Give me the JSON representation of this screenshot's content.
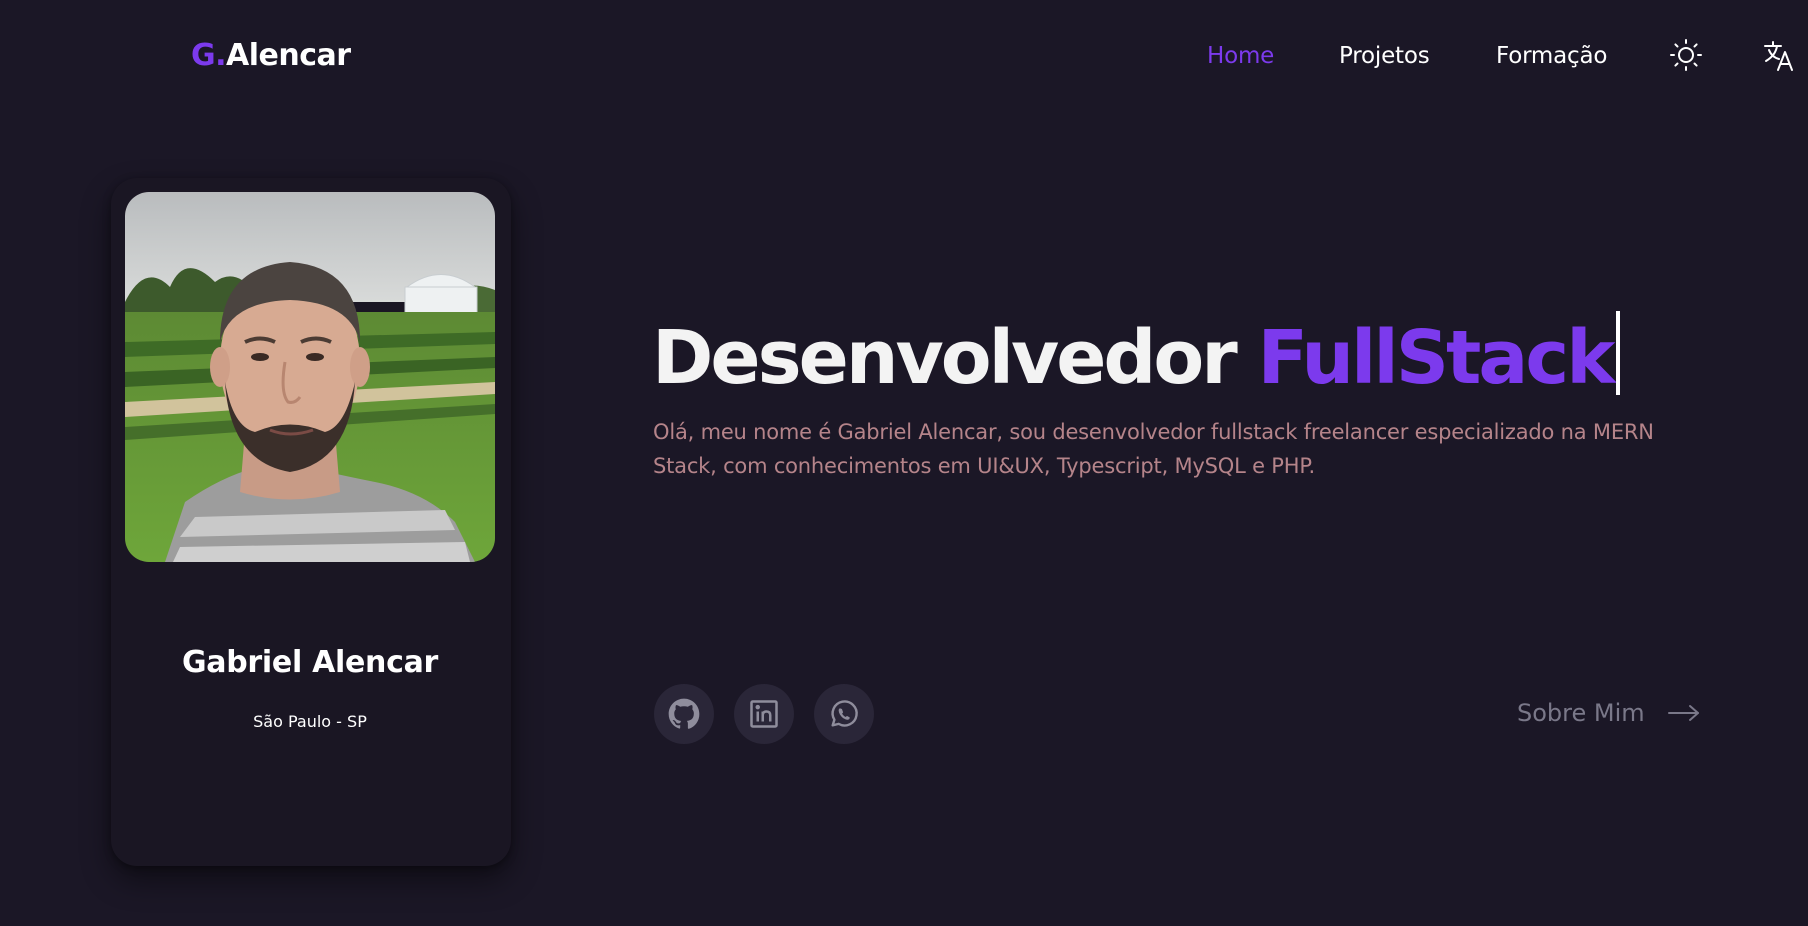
{
  "brand": {
    "accent": "G.",
    "rest": "Alencar"
  },
  "nav": {
    "home": "Home",
    "projetos": "Projetos",
    "formacao": "Formação",
    "theme_icon": "sun-icon",
    "lang_icon": "translate-icon"
  },
  "profile": {
    "name": "Gabriel Alencar",
    "location": "São Paulo - SP"
  },
  "hero": {
    "title_plain": "Desenvolvedor",
    "title_highlight": "FullStack",
    "description": "Olá, meu nome é Gabriel Alencar, sou desenvolvedor fullstack freelancer especializado na MERN Stack, com conhecimentos em UI&UX, Typescript, MySQL e PHP."
  },
  "social": {
    "icons": [
      "github-icon",
      "linkedin-icon",
      "whatsapp-icon"
    ]
  },
  "about": {
    "label": "Sobre Mim",
    "icon": "arrow-right-icon"
  },
  "colors": {
    "background": "#1b1726",
    "accent": "#7c3aed",
    "description_text": "#b5848a",
    "social_bg": "#2a2638",
    "muted": "#7a7889"
  }
}
